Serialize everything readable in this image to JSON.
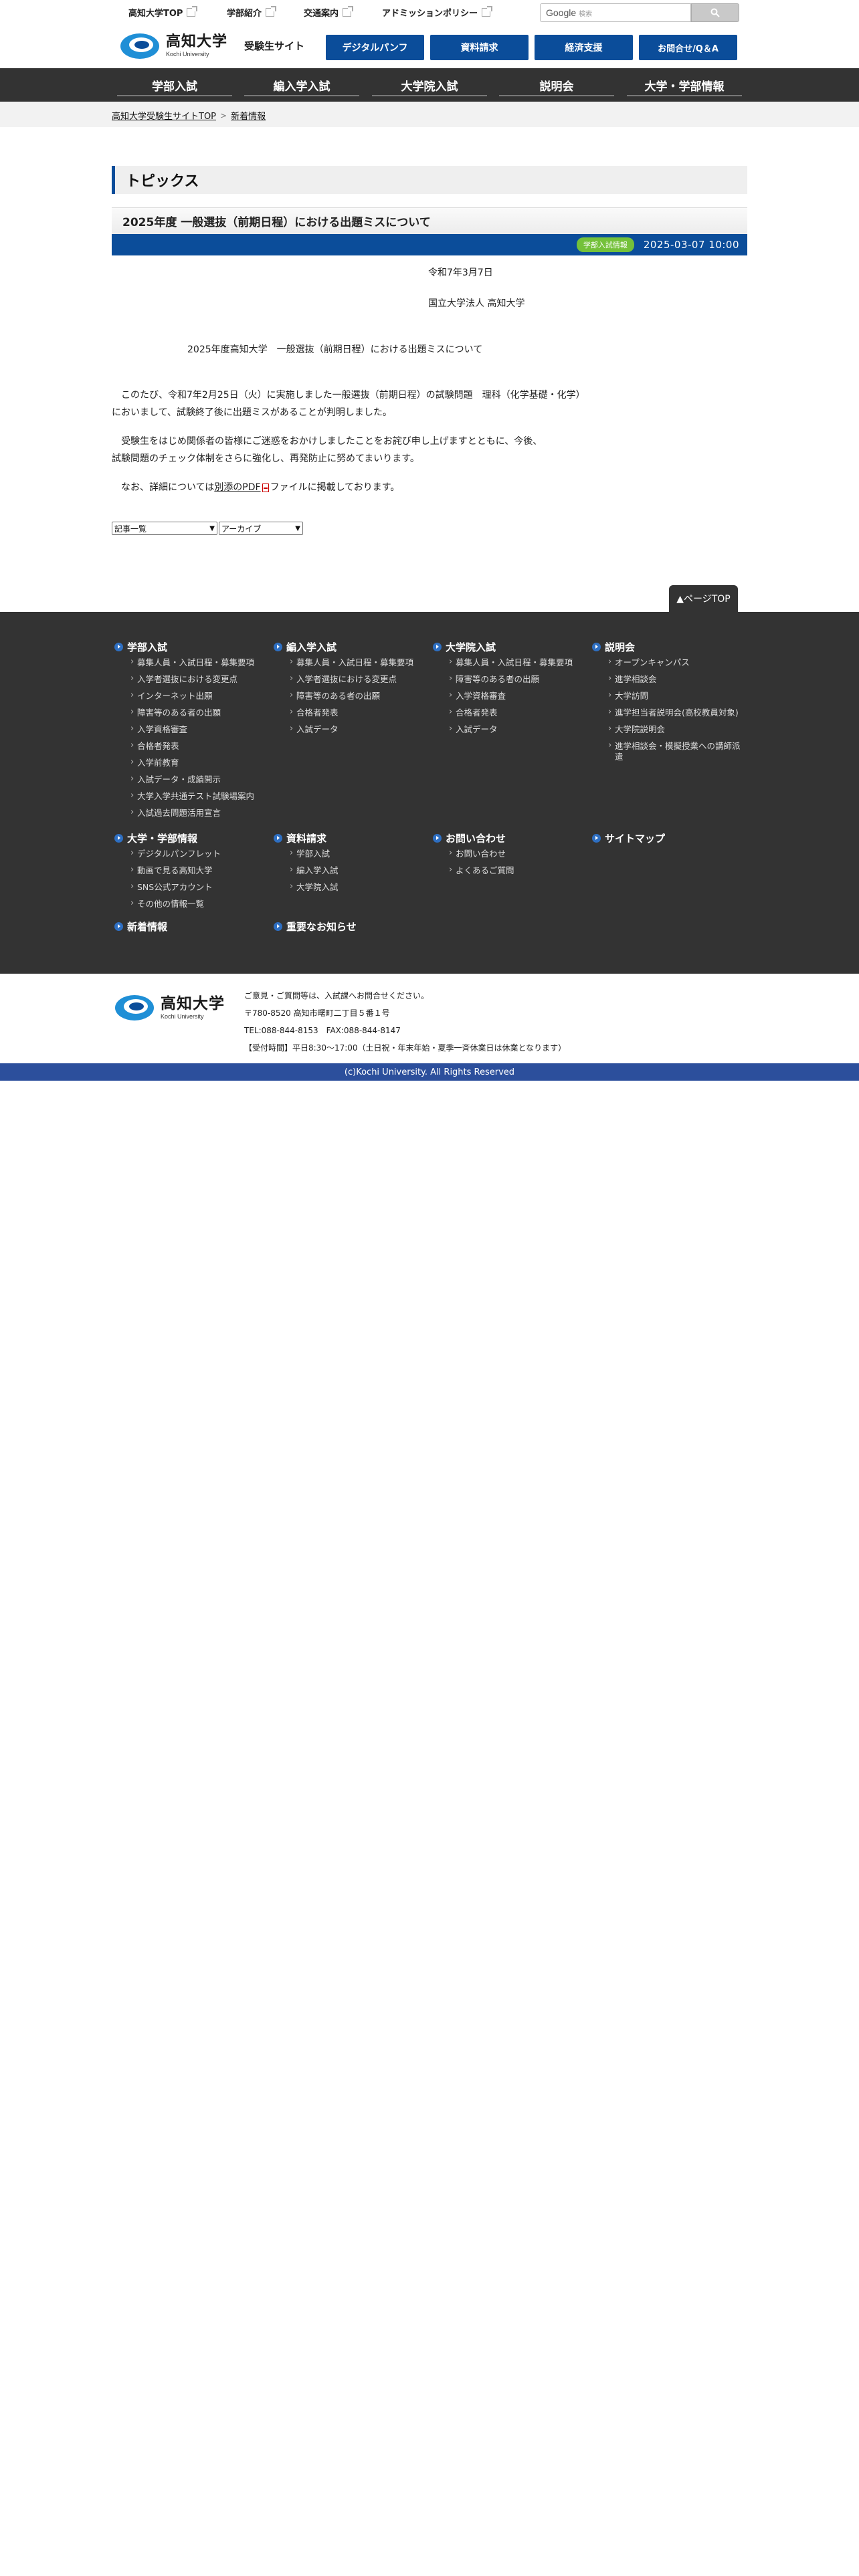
{
  "util": {
    "links": [
      "高知大学TOP",
      "学部紹介",
      "交通案内",
      "アドミッションポリシー"
    ],
    "search_brand": "Google",
    "search_placeholder": "検索"
  },
  "header": {
    "logo_jp": "高知大学",
    "logo_en": "Kochi University",
    "site_label": "受験生サイト",
    "buttons": [
      "デジタルパンフ",
      "資料請求",
      "経済支援",
      "お問合せ/Q＆A"
    ]
  },
  "gnav": [
    "学部入試",
    "編入学入試",
    "大学院入試",
    "説明会",
    "大学・学部情報"
  ],
  "breadcrumb": {
    "home": "高知大学受験生サイトTOP",
    "sep": ">",
    "current": "新着情報"
  },
  "main": {
    "section_title": "トピックス",
    "article_title": "2025年度 一般選抜（前期日程）における出題ミスについて",
    "tag": "学部入試情報",
    "date": "2025-03-07 10:00",
    "issue_date": "令和7年3月7日",
    "issuer": "国立大学法人 高知大学",
    "subject": "2025年度高知大学　一般選抜（前期日程）における出題ミスについて",
    "para1_line1": "　このたび、令和7年2月25日（火）に実施しました一般選抜（前期日程）の試験問題　理科（化学基礎・化学）",
    "para1_line2": "においまして、試験終了後に出題ミスがあることが判明しました。",
    "para2_line1": "　受験生をはじめ関係者の皆様にご迷惑をおかけしましたことをお詫び申し上げますとともに、今後、",
    "para2_line2": "試験問題のチェック体制をさらに強化し、再発防止に努めてまいります。",
    "para3_pre": "　なお、詳細については",
    "para3_link": "別添のPDF",
    "para3_post": "ファイルに掲載しております。",
    "select1": "記事一覧",
    "select2": "アーカイブ",
    "pagetop": "▲ページTOP"
  },
  "footer_nav": {
    "col1": {
      "head": "学部入試",
      "items": [
        "募集人員・入試日程・募集要項",
        "入学者選抜における変更点",
        "インターネット出願",
        "障害等のある者の出願",
        "入学資格審査",
        "合格者発表",
        "入学前教育",
        "入試データ・成績開示",
        "大学入学共通テスト試験場案内",
        "入試過去問題活用宣言"
      ]
    },
    "col2": {
      "head": "編入学入試",
      "items": [
        "募集人員・入試日程・募集要項",
        "入学者選抜における変更点",
        "障害等のある者の出願",
        "合格者発表",
        "入試データ"
      ]
    },
    "col3": {
      "head": "大学院入試",
      "items": [
        "募集人員・入試日程・募集要項",
        "障害等のある者の出願",
        "入学資格審査",
        "合格者発表",
        "入試データ"
      ]
    },
    "col4": {
      "head": "説明会",
      "items": [
        "オープンキャンパス",
        "進学相談会",
        "大学訪問",
        "進学担当者説明会(高校教員対象)",
        "大学院説明会",
        "進学相談会・模擬授業への講師派遣"
      ]
    },
    "col5": {
      "head": "大学・学部情報",
      "items": [
        "デジタルパンフレット",
        "動画で見る高知大学",
        "SNS公式アカウント",
        "その他の情報一覧"
      ]
    },
    "col6": {
      "head": "資料請求",
      "items": [
        "学部入試",
        "編入学入試",
        "大学院入試"
      ]
    },
    "col7": {
      "head": "お問い合わせ",
      "items": [
        "お問い合わせ",
        "よくあるご質問"
      ]
    },
    "col8": {
      "head": "サイトマップ"
    },
    "col9": {
      "head": "新着情報"
    },
    "col10": {
      "head": "重要なお知らせ"
    }
  },
  "footer_info": {
    "logo_jp": "高知大学",
    "logo_en": "Kochi University",
    "line1": "ご意見・ご質問等は、入試課へお問合せください。",
    "line2": "〒780-8520 高知市曙町二丁目５番１号",
    "line3": "TEL:088-844-8153　FAX:088-844-8147",
    "line4": "【受付時間】平日8:30～17:00（土日祝・年末年始・夏季一斉休業日は休業となります）",
    "copyright": "(c)Kochi University. All Rights Reserved"
  },
  "colors": {
    "brand_blue": "#0b4d9a",
    "nav_dark": "#333333",
    "tag_green": "#74c13a",
    "copyright_bar": "#2c4f9c"
  }
}
